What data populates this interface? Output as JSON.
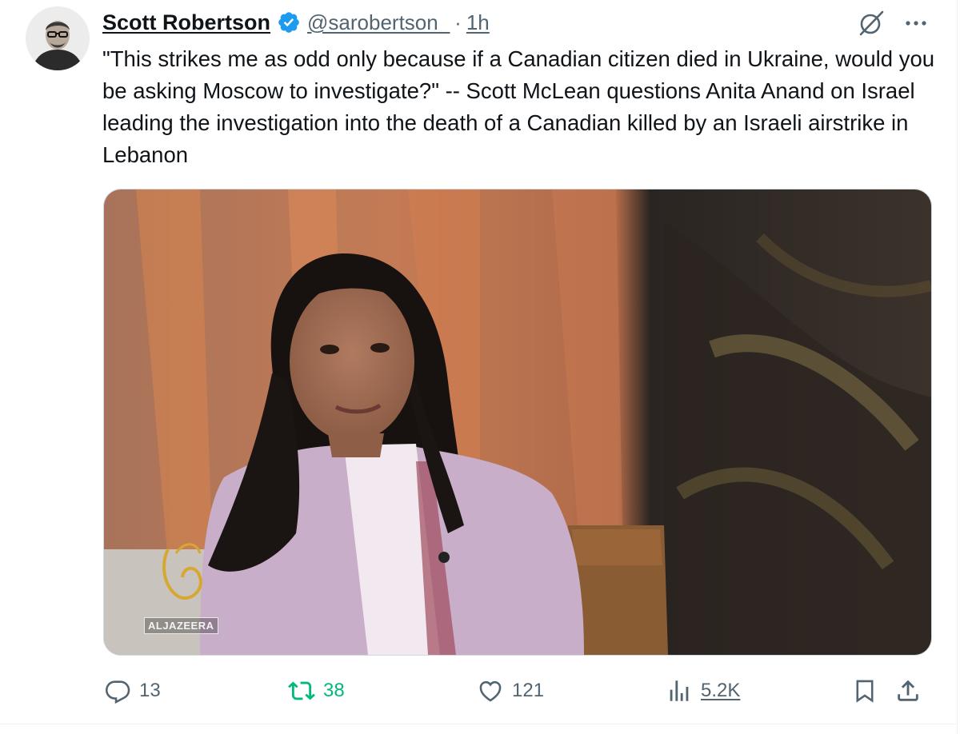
{
  "author": {
    "display_name": "Scott Robertson",
    "handle": "@sarobertson_",
    "separator": "·",
    "time": "1h"
  },
  "tweet": {
    "text": "\"This strikes me as odd only because if a Canadian citizen died in Ukraine, would you be asking Moscow to investigate?\" -- Scott McLean questions Anita Anand on Israel leading the investigation into the death of a Canadian killed by an Israeli airstrike in Lebanon"
  },
  "media": {
    "watermark_text": "ALJAZEERA"
  },
  "actions": {
    "replies": "13",
    "reposts": "38",
    "likes": "121",
    "views": "5.2K"
  },
  "colors": {
    "verified": "#1d9bf0",
    "repost_active": "#00ba7c",
    "muted": "#536471"
  },
  "icons": [
    "verified-badge-icon",
    "grok-icon",
    "more-icon",
    "reply-icon",
    "repost-icon",
    "like-icon",
    "views-icon",
    "bookmark-icon",
    "share-icon"
  ]
}
